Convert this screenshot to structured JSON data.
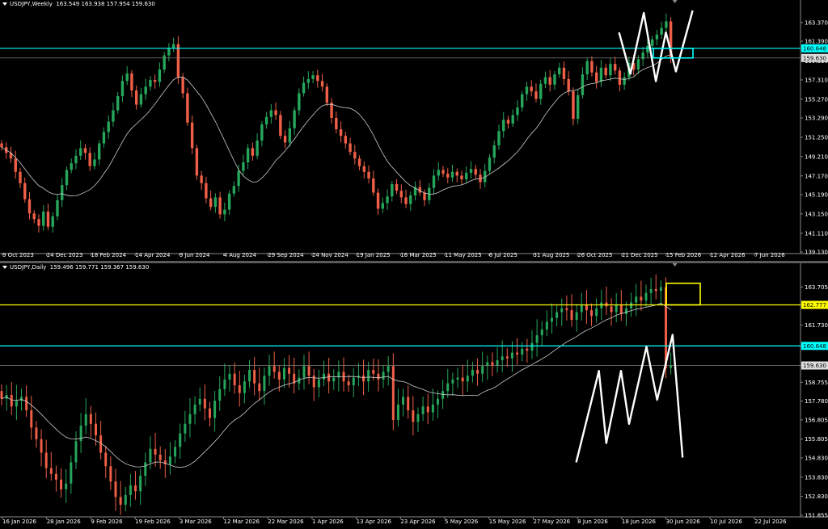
{
  "chart_data": [
    {
      "type": "candlestick",
      "title": "USDJPY,Weekly",
      "ohlc_readout": [
        "163.549",
        "163.938",
        "157.954",
        "159.630"
      ],
      "ylim": [
        139.13,
        164.9
      ],
      "y_ticks": [
        "163.370",
        "161.390",
        "159.310",
        "157.310",
        "155.270",
        "153.290",
        "151.250",
        "149.210",
        "147.170",
        "145.190",
        "143.150",
        "141.110",
        "139.130"
      ],
      "x_ticks": [
        "9 Oct 2023",
        "24 Dec 2023",
        "18 Feb 2024",
        "14 Apr 2024",
        "9 Jun 2024",
        "4 Aug 2024",
        "29 Sep 2024",
        "24 Nov 2024",
        "19 Jan 2025",
        "16 Mar 2025",
        "11 May 2025",
        "6 Jul 2025",
        "31 Aug 2025",
        "26 Oct 2025",
        "21 Dec 2025",
        "15 Feb 2026",
        "12 Apr 2026",
        "7 Jun 2026"
      ],
      "level_lines": [
        {
          "value": 160.648,
          "label": "160.648",
          "color": "#00ffff"
        },
        {
          "value": 159.63,
          "label": "159.630",
          "color": "#808080"
        }
      ],
      "close_series": [
        150.2,
        149.6,
        149.0,
        147.6,
        146.4,
        144.7,
        143.2,
        142.6,
        141.9,
        143.4,
        141.8,
        142.9,
        144.6,
        146.2,
        147.8,
        148.5,
        149.3,
        150.1,
        149.6,
        148.2,
        148.9,
        150.6,
        151.8,
        152.9,
        154.1,
        155.6,
        157.2,
        158.0,
        156.2,
        154.7,
        155.8,
        156.6,
        157.3,
        157.1,
        158.4,
        159.9,
        160.7,
        161.1,
        157.6,
        155.9,
        152.8,
        150.1,
        147.2,
        146.4,
        144.8,
        143.9,
        144.9,
        143.1,
        143.6,
        145.3,
        146.1,
        147.7,
        148.6,
        150.1,
        149.3,
        150.9,
        152.6,
        153.4,
        154.1,
        153.6,
        151.4,
        150.7,
        152.2,
        154.1,
        155.9,
        157.0,
        157.4,
        157.8,
        157.2,
        156.6,
        154.9,
        153.3,
        152.1,
        151.4,
        150.6,
        149.7,
        149.0,
        148.2,
        147.6,
        146.9,
        145.4,
        143.7,
        144.3,
        145.0,
        146.3,
        145.6,
        144.9,
        144.2,
        145.1,
        146.0,
        145.4,
        144.6,
        145.9,
        147.2,
        147.8,
        147.4,
        147.0,
        147.6,
        147.2,
        146.8,
        147.5,
        147.9,
        147.3,
        146.5,
        147.7,
        149.1,
        150.4,
        151.9,
        153.1,
        152.7,
        153.6,
        154.4,
        155.8,
        156.6,
        156.1,
        155.3,
        156.9,
        157.6,
        156.8,
        157.9,
        158.6,
        157.4,
        156.1,
        153.2,
        155.7,
        157.9,
        159.3,
        158.1,
        157.1,
        158.6,
        157.8,
        159.0,
        158.3,
        156.8,
        157.6,
        159.1,
        158.4,
        159.5,
        160.2,
        160.9,
        161.6,
        162.1,
        162.8,
        163.5,
        159.63
      ]
    },
    {
      "type": "candlestick",
      "title": "USDJPY,Daily",
      "ohlc_readout": [
        "159.496",
        "159.771",
        "159.367",
        "159.630"
      ],
      "ylim": [
        151.85,
        164.35
      ],
      "y_ticks": [
        "163.705",
        "162.777",
        "161.730",
        "160.648",
        "159.630",
        "158.755",
        "157.780",
        "156.805",
        "155.805",
        "154.830",
        "153.830",
        "152.830",
        "151.855"
      ],
      "x_ticks": [
        "16 Jan 2026",
        "28 Jan 2026",
        "9 Feb 2026",
        "19 Feb 2026",
        "3 Mar 2026",
        "12 Mar 2026",
        "22 Mar 2026",
        "1 Apr 2026",
        "13 Apr 2026",
        "23 Apr 2026",
        "5 May 2026",
        "15 May 2026",
        "27 May 2026",
        "8 Jun 2026",
        "18 Jun 2026",
        "30 Jun 2026",
        "10 Jul 2026",
        "22 Jul 2026"
      ],
      "level_lines": [
        {
          "value": 162.777,
          "label": "162.777",
          "color": "#ffff00"
        },
        {
          "value": 160.648,
          "label": "160.648",
          "color": "#00ffff"
        },
        {
          "value": 159.63,
          "label": "159.630",
          "color": "#808080"
        }
      ],
      "close_series": [
        157.9,
        158.1,
        157.5,
        157.8,
        158.0,
        157.3,
        156.4,
        155.8,
        155.1,
        154.3,
        154.0,
        153.7,
        153.2,
        153.5,
        154.6,
        155.7,
        156.5,
        157.1,
        156.6,
        156.0,
        155.1,
        154.4,
        153.6,
        152.8,
        152.4,
        152.9,
        153.4,
        153.1,
        153.9,
        154.6,
        155.3,
        155.0,
        154.7,
        154.5,
        154.9,
        155.4,
        156.1,
        156.6,
        157.1,
        157.6,
        157.9,
        157.4,
        156.9,
        157.8,
        158.4,
        158.9,
        159.2,
        158.6,
        158.2,
        158.8,
        159.4,
        158.7,
        158.3,
        159.1,
        159.6,
        159.3,
        158.9,
        159.5,
        159.2,
        158.7,
        159.0,
        159.6,
        159.1,
        158.5,
        158.9,
        159.2,
        158.8,
        159.0,
        159.3,
        158.8,
        158.6,
        159.0,
        159.1,
        158.8,
        159.4,
        159.2,
        158.9,
        159.3,
        159.6,
        156.8,
        157.6,
        158.0,
        157.3,
        156.7,
        157.1,
        157.5,
        157.2,
        157.6,
        157.9,
        158.3,
        158.7,
        158.9,
        159.0,
        158.8,
        159.1,
        159.4,
        159.2,
        159.6,
        159.8,
        159.6,
        159.9,
        160.1,
        160.0,
        160.3,
        160.2,
        160.5,
        160.4,
        160.8,
        161.2,
        161.5,
        161.9,
        162.1,
        162.4,
        162.6,
        162.5,
        162.0,
        162.4,
        162.8,
        162.5,
        162.2,
        162.6,
        162.9,
        162.7,
        162.4,
        162.8,
        162.3,
        162.6,
        162.9,
        163.2,
        163.0,
        163.4,
        163.6,
        163.5,
        163.7,
        159.5,
        159.63
      ]
    }
  ]
}
